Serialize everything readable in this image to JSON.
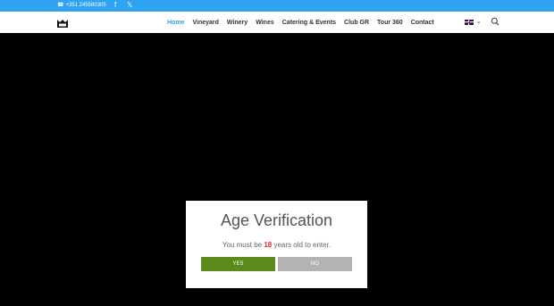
{
  "topbar": {
    "phone": "+351 245580305",
    "social": [
      "facebook-icon",
      "x-icon"
    ]
  },
  "header": {
    "logo": "crown-logo",
    "nav": [
      {
        "label": "Home",
        "active": true
      },
      {
        "label": "Vineyard",
        "active": false
      },
      {
        "label": "Winery",
        "active": false
      },
      {
        "label": "Wines",
        "active": false
      },
      {
        "label": "Catering & Events",
        "active": false
      },
      {
        "label": "Club GR",
        "active": false
      },
      {
        "label": "Tour 360",
        "active": false
      },
      {
        "label": "Contact",
        "active": false
      }
    ],
    "language": "uk-flag-icon",
    "search_icon": "search-icon"
  },
  "modal": {
    "title": "Age Verification",
    "text_before": "You must be ",
    "age": "18",
    "text_after": " years old to enter.",
    "yes": "YES",
    "no": "NO"
  },
  "colors": {
    "topbar": "#2ea3f2",
    "accent": "#2ea3f2",
    "yes_button": "#5c8a1d",
    "no_button": "#b3b3b3",
    "age": "#e02b20"
  }
}
